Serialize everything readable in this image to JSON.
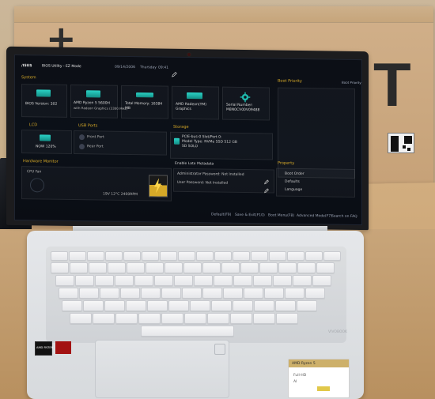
{
  "scene": {
    "description_tag": "photo-laptop-bios",
    "colors": {
      "accent_gold": "#d6a928",
      "teal": "#2bd2c5",
      "cardboard": "#c8ad86"
    }
  },
  "box": {
    "plus_glyph": "+",
    "letter_T": "T"
  },
  "bios": {
    "brand": "/ISUS",
    "title": "BIOS Utility - EZ Mode",
    "date": "09/14/2006",
    "day": "Thursday",
    "time": "09:41",
    "sections": {
      "system": "System",
      "boot_priority": "Boot Priority",
      "storage": "Storage",
      "hardware_monitor": "Hardware Monitor",
      "property": "Property",
      "usb_ports": "USB Ports",
      "lcd": "LCD"
    },
    "system_tiles": [
      {
        "label": "BIOS Version: 302",
        "sub": ""
      },
      {
        "label": "AMD Ryzen 5 5600H",
        "sub": "with Radeon Graphics (3300 MHz)"
      },
      {
        "label": "Total Memory: 16384",
        "sub": "MB"
      },
      {
        "label": "AMD Radeon(TM)",
        "sub": "Graphics"
      },
      {
        "label": "Serial Number:",
        "sub": "M8N0CV00V09488"
      }
    ],
    "usb": [
      {
        "label": "Front Port"
      },
      {
        "label": "Rear Port"
      }
    ],
    "lcd_text": "NOW 120%",
    "storage_text": [
      "PCIE-bus-0 Slot/Port 0:",
      "Model Type: NVMe SSD 512 GB",
      "SD SOLO"
    ],
    "hw_monitor": {
      "cpu_label": "CPU Fan",
      "voltage": "19V 12°C 2400RPM"
    },
    "security": {
      "title": "Enable Late Metadata",
      "rows": [
        "Administrator Password: Not Installed",
        "User Password: Not Installed"
      ]
    },
    "property": [
      "Boot Order",
      "Defaults",
      "Language"
    ],
    "footer": [
      "Default(F9)",
      "Save & Exit(F10)",
      "Boot Menu(F8)",
      "Advanced Mode(F7)",
      "Search on FAQ"
    ],
    "advanced_link": "Boot Priority"
  },
  "laptop": {
    "brand_badge": "VIVOBOOK",
    "sticker_amd": "AMD RYZEN",
    "sticker_label": "AMD Ryzen 5",
    "sticker_features": [
      "Full-HD",
      "AI"
    ]
  }
}
